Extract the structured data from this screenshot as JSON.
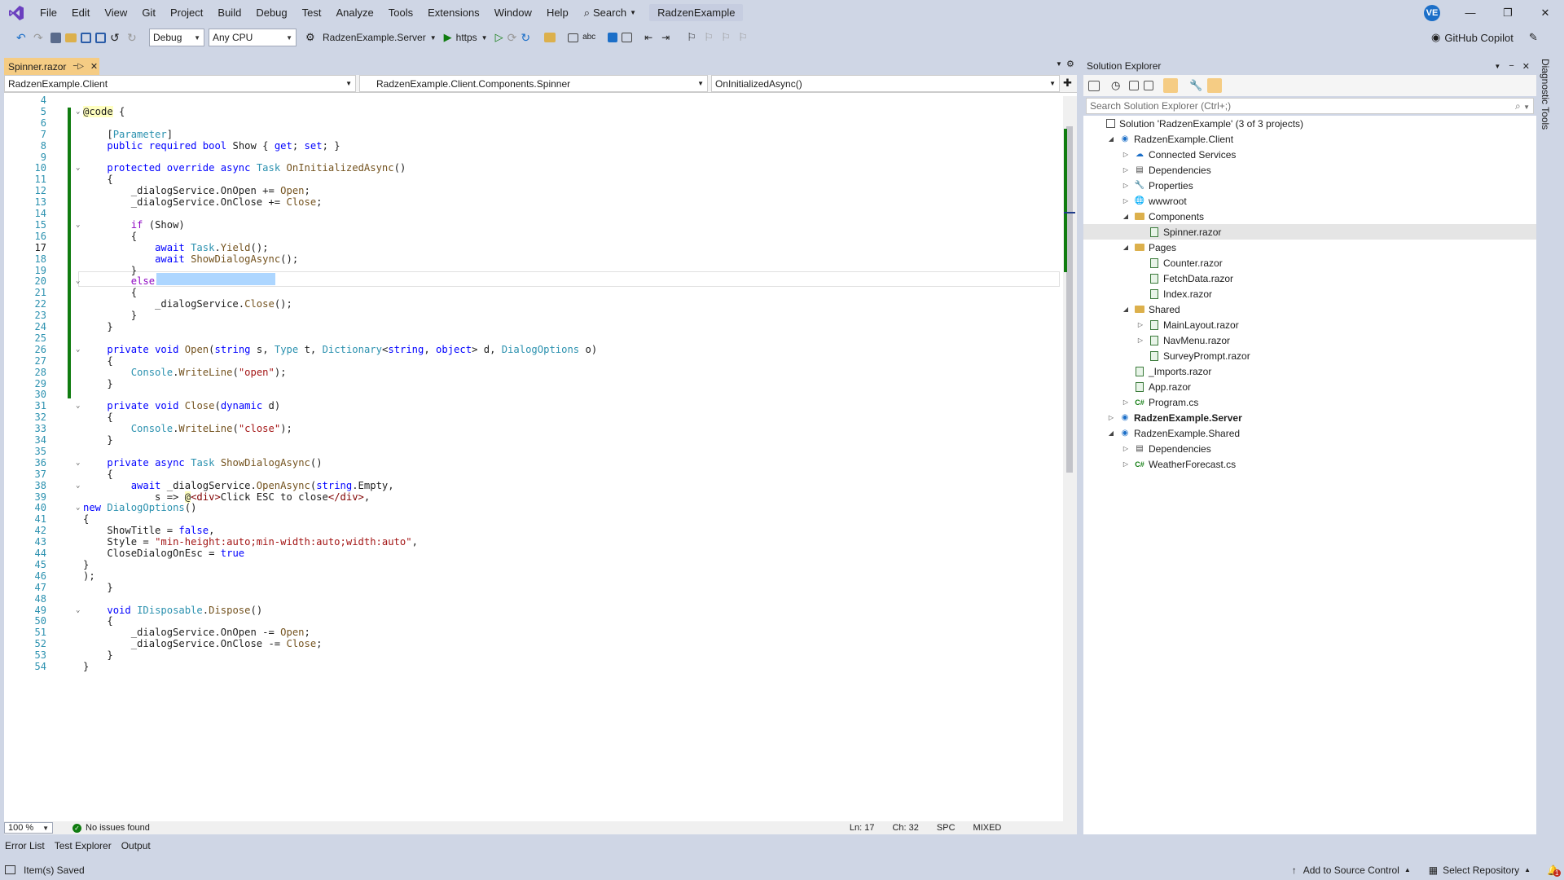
{
  "titlebar": {
    "menus": [
      "File",
      "Edit",
      "View",
      "Git",
      "Project",
      "Build",
      "Debug",
      "Test",
      "Analyze",
      "Tools",
      "Extensions",
      "Window",
      "Help"
    ],
    "search_label": "Search",
    "solution_name": "RadzenExample",
    "avatar_initials": "VE"
  },
  "toolbar": {
    "config": "Debug",
    "platform": "Any CPU",
    "startup_project": "RadzenExample.Server",
    "run_profile": "https",
    "copilot": "GitHub Copilot"
  },
  "editor": {
    "tab_name": "Spinner.razor",
    "nav_project": "RadzenExample.Client",
    "nav_class": "RadzenExample.Client.Components.Spinner",
    "nav_member": "OnInitializedAsync()",
    "zoom": "100 %",
    "issues": "No issues found",
    "line": "Ln: 17",
    "col": "Ch: 32",
    "whitespace": "SPC",
    "line_endings": "MIXED"
  },
  "code_lines": [
    {
      "n": "4",
      "t": ""
    },
    {
      "n": "5",
      "t": "@code {"
    },
    {
      "n": "6",
      "t": ""
    },
    {
      "n": "7",
      "t": "    [Parameter]"
    },
    {
      "n": "8",
      "t": "    public required bool Show { get; set; }"
    },
    {
      "n": "9",
      "t": ""
    },
    {
      "n": "10",
      "t": "    protected override async Task OnInitializedAsync()"
    },
    {
      "n": "11",
      "t": "    {"
    },
    {
      "n": "12",
      "t": "        _dialogService.OnOpen += Open;"
    },
    {
      "n": "13",
      "t": "        _dialogService.OnClose += Close;"
    },
    {
      "n": "14",
      "t": ""
    },
    {
      "n": "15",
      "t": "        if (Show)"
    },
    {
      "n": "16",
      "t": "        {"
    },
    {
      "n": "17",
      "t": "            await Task.Yield();"
    },
    {
      "n": "18",
      "t": "            await ShowDialogAsync();"
    },
    {
      "n": "19",
      "t": "        }"
    },
    {
      "n": "20",
      "t": "        else"
    },
    {
      "n": "21",
      "t": "        {"
    },
    {
      "n": "22",
      "t": "            _dialogService.Close();"
    },
    {
      "n": "23",
      "t": "        }"
    },
    {
      "n": "24",
      "t": "    }"
    },
    {
      "n": "25",
      "t": ""
    },
    {
      "n": "26",
      "t": "    private void Open(string s, Type t, Dictionary<string, object> d, DialogOptions o)"
    },
    {
      "n": "27",
      "t": "    {"
    },
    {
      "n": "28",
      "t": "        Console.WriteLine(\"open\");"
    },
    {
      "n": "29",
      "t": "    }"
    },
    {
      "n": "30",
      "t": ""
    },
    {
      "n": "31",
      "t": "    private void Close(dynamic d)"
    },
    {
      "n": "32",
      "t": "    {"
    },
    {
      "n": "33",
      "t": "        Console.WriteLine(\"close\");"
    },
    {
      "n": "34",
      "t": "    }"
    },
    {
      "n": "35",
      "t": ""
    },
    {
      "n": "36",
      "t": "    private async Task ShowDialogAsync()"
    },
    {
      "n": "37",
      "t": "    {"
    },
    {
      "n": "38",
      "t": "        await _dialogService.OpenAsync(string.Empty,"
    },
    {
      "n": "39",
      "t": "            s => @<div>Click ESC to close</div>,"
    },
    {
      "n": "40",
      "t": "new DialogOptions()"
    },
    {
      "n": "41",
      "t": "{"
    },
    {
      "n": "42",
      "t": "    ShowTitle = false,"
    },
    {
      "n": "43",
      "t": "    Style = \"min-height:auto;min-width:auto;width:auto\","
    },
    {
      "n": "44",
      "t": "    CloseDialogOnEsc = true"
    },
    {
      "n": "45",
      "t": "}"
    },
    {
      "n": "46",
      "t": ");"
    },
    {
      "n": "47",
      "t": "    }"
    },
    {
      "n": "48",
      "t": ""
    },
    {
      "n": "49",
      "t": "    void IDisposable.Dispose()"
    },
    {
      "n": "50",
      "t": "    {"
    },
    {
      "n": "51",
      "t": "        _dialogService.OnOpen -= Open;"
    },
    {
      "n": "52",
      "t": "        _dialogService.OnClose -= Close;"
    },
    {
      "n": "53",
      "t": "    }"
    },
    {
      "n": "54",
      "t": "}"
    }
  ],
  "solution_explorer": {
    "title": "Solution Explorer",
    "search_placeholder": "Search Solution Explorer (Ctrl+;)",
    "items": [
      {
        "label": "Solution 'RadzenExample' (3 of 3 projects)",
        "indent": 0,
        "exp": "",
        "icon": "solution"
      },
      {
        "label": "RadzenExample.Client",
        "indent": 1,
        "exp": "open",
        "icon": "project"
      },
      {
        "label": "Connected Services",
        "indent": 2,
        "exp": "closed",
        "icon": "connected"
      },
      {
        "label": "Dependencies",
        "indent": 2,
        "exp": "closed",
        "icon": "deps"
      },
      {
        "label": "Properties",
        "indent": 2,
        "exp": "closed",
        "icon": "props"
      },
      {
        "label": "wwwroot",
        "indent": 2,
        "exp": "closed",
        "icon": "globe"
      },
      {
        "label": "Components",
        "indent": 2,
        "exp": "open",
        "icon": "folder"
      },
      {
        "label": "Spinner.razor",
        "indent": 3,
        "exp": "",
        "icon": "razor",
        "selected": true
      },
      {
        "label": "Pages",
        "indent": 2,
        "exp": "open",
        "icon": "folder"
      },
      {
        "label": "Counter.razor",
        "indent": 3,
        "exp": "",
        "icon": "razor"
      },
      {
        "label": "FetchData.razor",
        "indent": 3,
        "exp": "",
        "icon": "razor"
      },
      {
        "label": "Index.razor",
        "indent": 3,
        "exp": "",
        "icon": "razor"
      },
      {
        "label": "Shared",
        "indent": 2,
        "exp": "open",
        "icon": "folder"
      },
      {
        "label": "MainLayout.razor",
        "indent": 3,
        "exp": "closed",
        "icon": "razor"
      },
      {
        "label": "NavMenu.razor",
        "indent": 3,
        "exp": "closed",
        "icon": "razor"
      },
      {
        "label": "SurveyPrompt.razor",
        "indent": 3,
        "exp": "",
        "icon": "razor"
      },
      {
        "label": "_Imports.razor",
        "indent": 2,
        "exp": "",
        "icon": "razor"
      },
      {
        "label": "App.razor",
        "indent": 2,
        "exp": "",
        "icon": "razor"
      },
      {
        "label": "Program.cs",
        "indent": 2,
        "exp": "closed",
        "icon": "cs"
      },
      {
        "label": "RadzenExample.Server",
        "indent": 1,
        "exp": "closed",
        "icon": "project",
        "bold": true
      },
      {
        "label": "RadzenExample.Shared",
        "indent": 1,
        "exp": "open",
        "icon": "project"
      },
      {
        "label": "Dependencies",
        "indent": 2,
        "exp": "closed",
        "icon": "deps"
      },
      {
        "label": "WeatherForecast.cs",
        "indent": 2,
        "exp": "closed",
        "icon": "cs"
      }
    ]
  },
  "side_panel": "Diagnostic Tools",
  "bottom_tabs": [
    "Error List",
    "Test Explorer",
    "Output"
  ],
  "statusbar": {
    "message": "Item(s) Saved",
    "source_control": "Add to Source Control",
    "repo": "Select Repository",
    "notifications": "1"
  },
  "colors": {
    "accent": "#1c6fc8",
    "tab_active": "#f5cc84",
    "chrome": "#cfd6e5",
    "green": "#107c10"
  }
}
